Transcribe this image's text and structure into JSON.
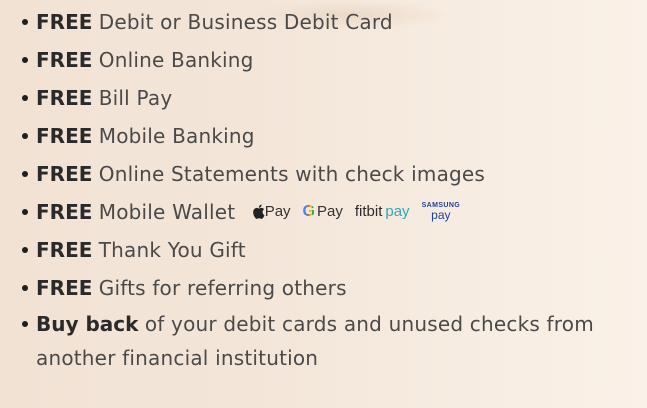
{
  "benefits": [
    {
      "strong": "FREE",
      "text": "Debit or Business Debit Card"
    },
    {
      "strong": "FREE",
      "text": "Online Banking"
    },
    {
      "strong": "FREE",
      "text": "Bill Pay"
    },
    {
      "strong": "FREE",
      "text": "Mobile Banking"
    },
    {
      "strong": "FREE",
      "text": "Online Statements with check images"
    },
    {
      "strong": "FREE",
      "text": "Mobile Wallet"
    },
    {
      "strong": "FREE",
      "text": "Thank You Gift"
    },
    {
      "strong": "FREE",
      "text": "Gifts for referring others"
    },
    {
      "strong": "Buy back",
      "text": "of your debit cards and unused checks from another financial institution"
    }
  ],
  "wallet_logos": {
    "apple_pay": "Pay",
    "google_pay_g": "G",
    "google_pay": "Pay",
    "fitbit": "fitbit",
    "fitbit_pay": "pay",
    "samsung": "SAMSUNG",
    "samsung_pay": "pay"
  },
  "colors": {
    "bullet": "#1e1e1e",
    "text": "#4a4a4a",
    "fitbit_pay": "#2fa8b8",
    "samsung_pay": "#1f3fa6"
  },
  "icons": [
    "bullet-icon",
    "apple-logo-icon",
    "google-g-icon"
  ]
}
